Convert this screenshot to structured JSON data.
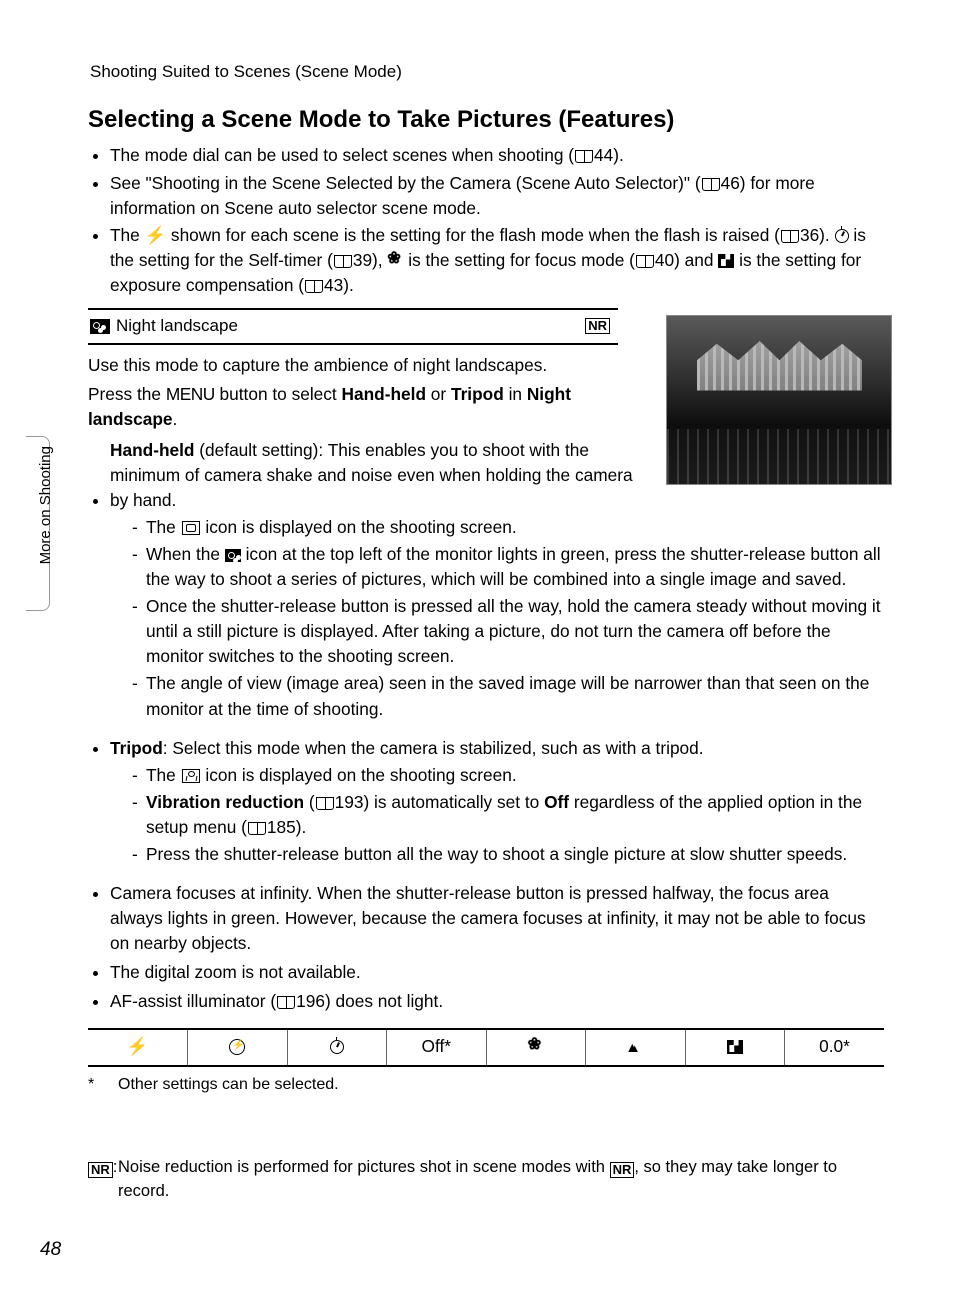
{
  "header": "Shooting Suited to Scenes (Scene Mode)",
  "sideTab": "More on Shooting",
  "title": "Selecting a Scene Mode to Take Pictures (Features)",
  "bullets": {
    "b1a": "The mode dial can be used to select scenes when shooting (",
    "b1b": "44).",
    "b2a": "See \"Shooting in the Scene Selected by the Camera (Scene Auto Selector)\" (",
    "b2b": "46) for more information on Scene auto selector scene mode.",
    "b3a": "The ",
    "b3b": " shown for each scene is the setting for the flash mode when the flash is raised (",
    "b3c": "36). ",
    "b3d": " is the setting for the Self-timer (",
    "b3e": "39), ",
    "b3f": " is the setting for focus mode (",
    "b3g": "40) and ",
    "b3h": " is the setting for exposure compensation (",
    "b3i": "43)."
  },
  "scene": {
    "name": "Night landscape",
    "nr": "NR",
    "p1": "Use this mode to capture the ambience of night landscapes.",
    "p2a": "Press the ",
    "p2menu": "MENU",
    "p2b": " button to select ",
    "p2c": "Hand-held",
    "p2d": " or ",
    "p2e": "Tripod",
    "p2f": " in ",
    "p2g": "Night landscape",
    "p2h": "."
  },
  "handheld": {
    "label": "Hand-held",
    "desc": " (default setting): This enables you to shoot with the minimum of camera shake and noise even when holding the camera by hand.",
    "d1a": "The ",
    "d1b": " icon is displayed on the shooting screen.",
    "d2a": "When the ",
    "d2b": " icon at the top left of the monitor lights in green, press the shutter-release button all the way to shoot a series of pictures, which will be combined into a single image and saved.",
    "d3": "Once the shutter-release button is pressed all the way, hold the camera steady without moving it until a still picture is displayed. After taking a picture, do not turn the camera off before the monitor switches to the shooting screen.",
    "d4": "The angle of view (image area) seen in the saved image will be narrower than that seen on the monitor at the time of shooting."
  },
  "tripod": {
    "label": "Tripod",
    "desc": ": Select this mode when the camera is stabilized, such as with a tripod.",
    "d1a": "The ",
    "d1b": " icon is displayed on the shooting screen.",
    "d2a": "Vibration reduction",
    "d2b": " (",
    "d2c": "193) is automatically set to ",
    "d2d": "Off",
    "d2e": " regardless of the applied option in the setup menu (",
    "d2f": "185).",
    "d3": "Press the shutter-release button all the way to shoot a single picture at slow shutter speeds."
  },
  "extra": {
    "e1": "Camera focuses at infinity. When the shutter-release button is pressed halfway, the focus area always lights in green. However, because the camera focuses at infinity, it may not be able to focus on nearby objects.",
    "e2": "The digital zoom is not available.",
    "e3a": "AF-assist illuminator (",
    "e3b": "196) does not light."
  },
  "table": {
    "c3": "Off*",
    "c7": "0.0*"
  },
  "footnote": {
    "mark": "*",
    "text": "Other settings can be selected."
  },
  "nrNote": {
    "labelSuffix": ":",
    "textA": "Noise reduction is performed for pictures shot in scene modes with ",
    "textB": ", so they may take longer to record."
  },
  "pageNumber": "48"
}
